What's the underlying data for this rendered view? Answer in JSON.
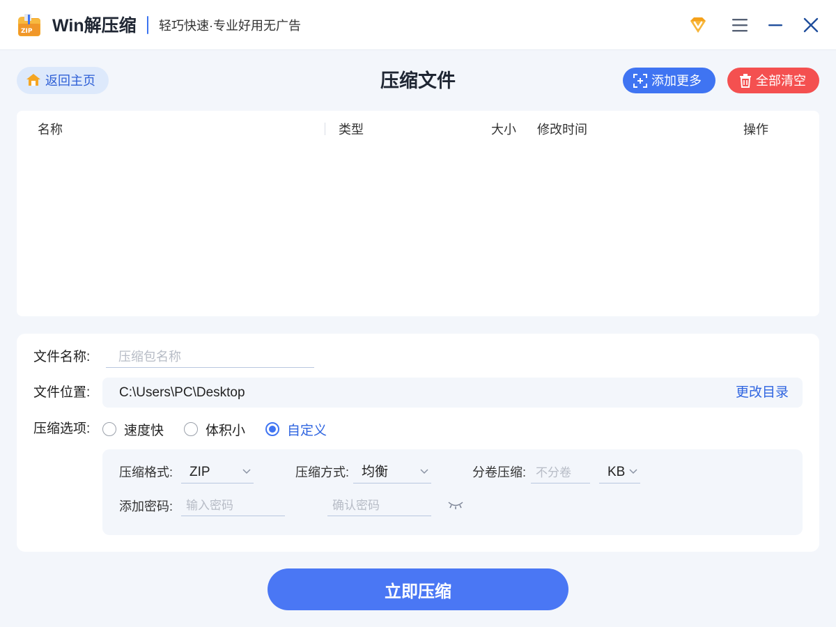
{
  "app": {
    "name": "Win解压缩",
    "slogan": "轻巧快速·专业好用无广告",
    "logo_text": "ZIP"
  },
  "window_controls": [
    "vip-icon",
    "menu-icon",
    "minimize-icon",
    "close-icon"
  ],
  "toolbar": {
    "home_label": "返回主页",
    "page_title": "压缩文件",
    "add_more_label": "添加更多",
    "clear_all_label": "全部清空"
  },
  "file_table": {
    "columns": [
      "名称",
      "类型",
      "大小",
      "修改时间",
      "操作"
    ],
    "rows": []
  },
  "options": {
    "filename_label": "文件名称:",
    "filename_value": "",
    "filename_placeholder": "压缩包名称",
    "location_label": "文件位置:",
    "location_path": "C:\\Users\\PC\\Desktop",
    "change_dir_label": "更改目录",
    "compress_options_label": "压缩选项:",
    "modes": [
      {
        "label": "速度快",
        "checked": false
      },
      {
        "label": "体积小",
        "checked": false
      },
      {
        "label": "自定义",
        "checked": true
      }
    ],
    "custom": {
      "format_label": "压缩格式:",
      "format_value": "ZIP",
      "method_label": "压缩方式:",
      "method_value": "均衡",
      "split_label": "分卷压缩:",
      "split_placeholder": "不分卷",
      "split_unit": "KB",
      "password_label": "添加密码:",
      "password_placeholder": "输入密码",
      "confirm_placeholder": "确认密码"
    }
  },
  "colors": {
    "accent": "#3f74f2",
    "danger": "#f45050",
    "background": "#f3f6fb"
  },
  "compress_button_label": "立即压缩"
}
